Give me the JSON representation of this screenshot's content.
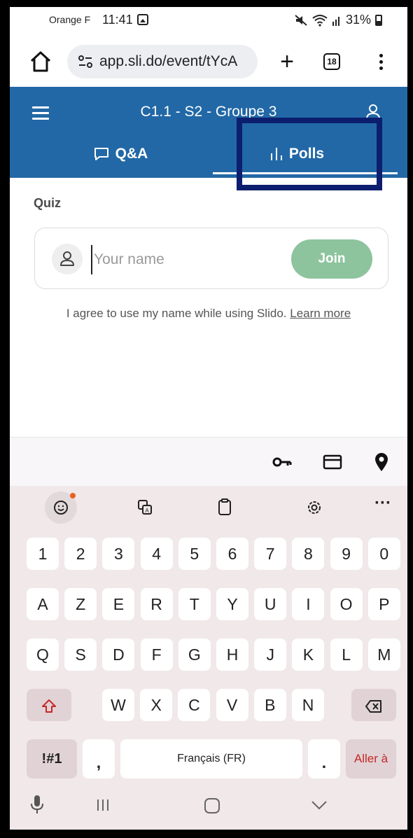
{
  "status_bar": {
    "carrier": "Orange F",
    "time": "11:41",
    "battery": "31%"
  },
  "browser": {
    "url": "app.sli.do/event/tYcA",
    "tab_count": "18"
  },
  "header": {
    "event_title": "C1.1 - S2 - Groupe 3",
    "tabs": [
      {
        "label": "Q&A"
      },
      {
        "label": "Polls"
      }
    ]
  },
  "main": {
    "section_label": "Quiz",
    "name_placeholder": "Your name",
    "join_label": "Join",
    "consent_text": "I agree to use my name while using Slido.",
    "learn_more": "Learn more"
  },
  "keyboard": {
    "rows": [
      [
        "1",
        "2",
        "3",
        "4",
        "5",
        "6",
        "7",
        "8",
        "9",
        "0"
      ],
      [
        "A",
        "Z",
        "E",
        "R",
        "T",
        "Y",
        "U",
        "I",
        "O",
        "P"
      ],
      [
        "Q",
        "S",
        "D",
        "F",
        "G",
        "H",
        "J",
        "K",
        "L",
        "M"
      ],
      [
        "W",
        "X",
        "C",
        "V",
        "B",
        "N"
      ]
    ],
    "symbols_label": "!#1",
    "comma": ",",
    "space_label": "Français (FR)",
    "period": ".",
    "enter_label": "Aller à",
    "more_label": "···"
  },
  "colors": {
    "header_bg": "#2268a6",
    "join_button": "#8dc49e",
    "highlight_border": "#0c1e6e",
    "shift_arrow": "#c62828",
    "enter_text": "#c62828"
  }
}
